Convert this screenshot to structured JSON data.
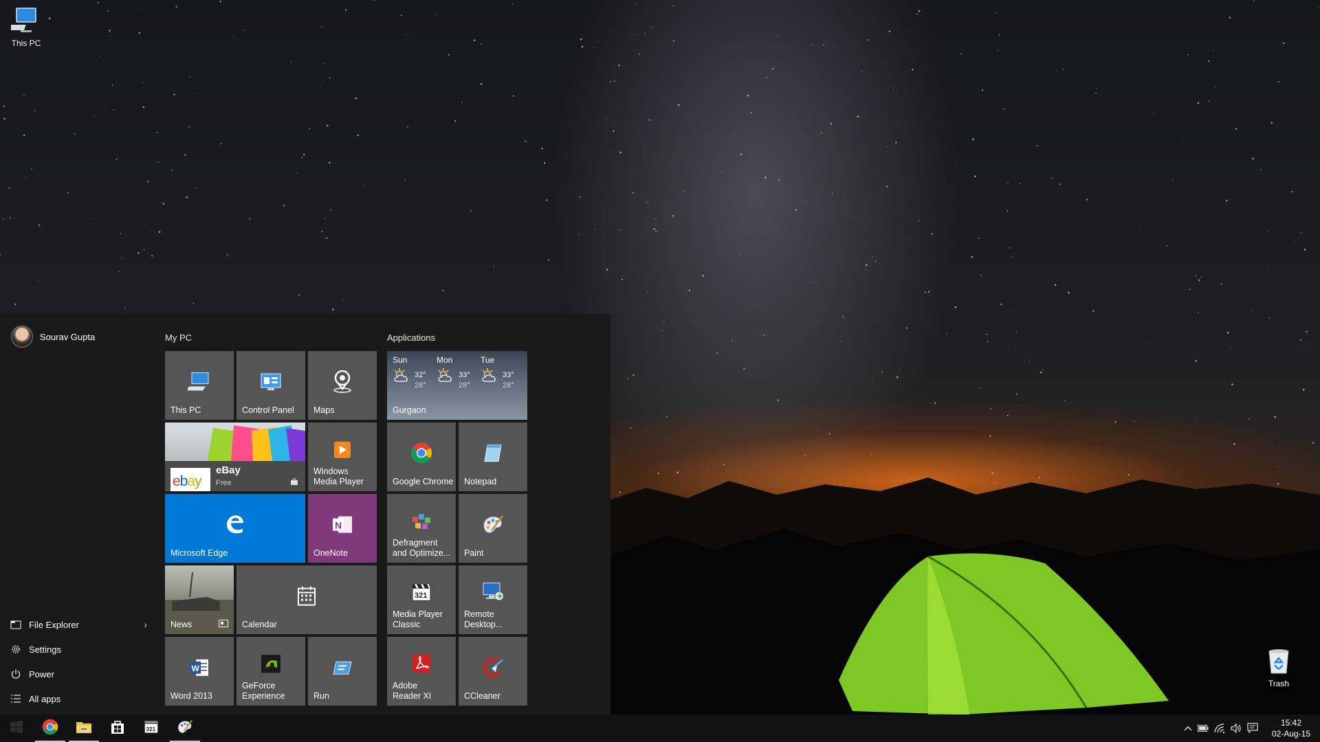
{
  "desktop": {
    "icons": [
      {
        "label": "This PC",
        "icon": "this-pc-icon"
      },
      {
        "label": "Trash",
        "icon": "recycle-bin-icon"
      }
    ]
  },
  "start_menu": {
    "user": {
      "name": "Sourav Gupta"
    },
    "left_items": [
      {
        "label": "File Explorer",
        "icon": "file-explorer-icon",
        "has_submenu": true
      },
      {
        "label": "Settings",
        "icon": "gear-icon"
      },
      {
        "label": "Power",
        "icon": "power-icon"
      },
      {
        "label": "All apps",
        "icon": "list-icon"
      }
    ],
    "groups": [
      {
        "title": "My PC"
      },
      {
        "title": "Applications"
      }
    ],
    "tiles": {
      "this_pc": "This PC",
      "control_panel": "Control Panel",
      "maps": "Maps",
      "ebay": {
        "name": "eBay",
        "price": "Free",
        "logo": "ebay"
      },
      "wmp": "Windows Media Player",
      "edge": "Microsoft Edge",
      "onenote": "OneNote",
      "news": "News",
      "calendar": "Calendar",
      "word": "Word 2013",
      "geforce": "GeForce Experience",
      "run": "Run",
      "weather": {
        "location": "Gurgaon",
        "days": [
          {
            "day": "Sun",
            "high": "32°",
            "low": "28°"
          },
          {
            "day": "Mon",
            "high": "33°",
            "low": "28°"
          },
          {
            "day": "Tue",
            "high": "33°",
            "low": "28°"
          }
        ]
      },
      "chrome": "Google Chrome",
      "notepad": "Notepad",
      "defrag": "Defragment and Optimize...",
      "paint": "Paint",
      "mpc": "Media Player Classic",
      "remote": "Remote Desktop...",
      "adobe": "Adobe Reader XI",
      "ccleaner": "CCleaner"
    },
    "tile_colors": {
      "default": "#555555",
      "edge": "#0078d7",
      "onenote": "#80397b"
    }
  },
  "taskbar": {
    "pinned": [
      "start-icon",
      "chrome-icon",
      "file-explorer-icon",
      "store-icon",
      "media-player-classic-icon",
      "paint-icon"
    ],
    "tray": [
      "chevron-up-icon",
      "battery-icon",
      "wifi-icon",
      "volume-icon",
      "action-center-icon"
    ],
    "clock": {
      "time": "15:42",
      "date": "02-Aug-15"
    }
  }
}
